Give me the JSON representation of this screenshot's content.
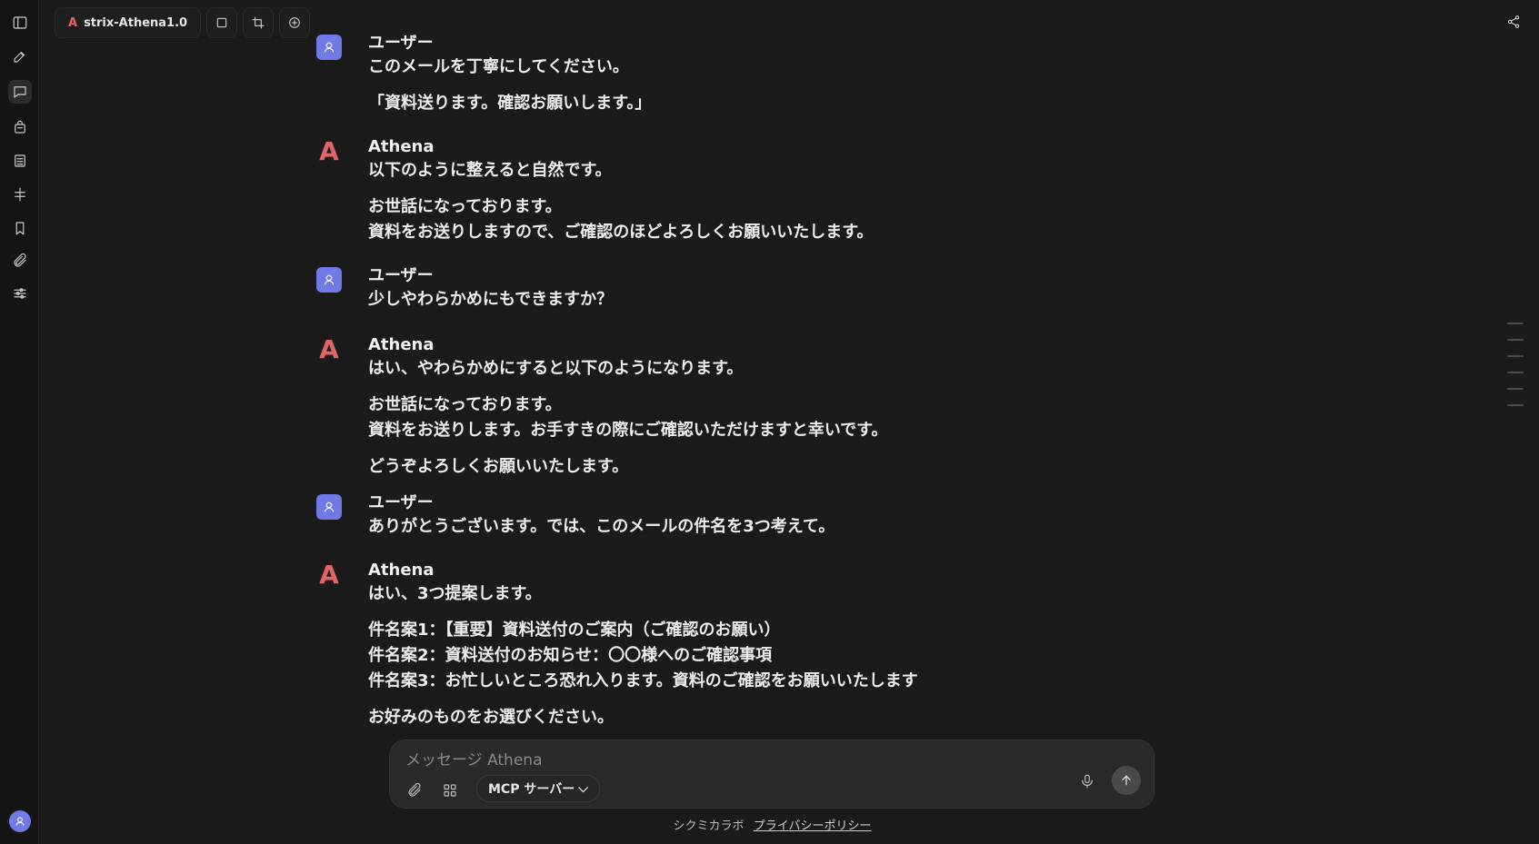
{
  "topbar": {
    "model_logo": "A",
    "model_name": "strix-Athena1.0"
  },
  "messages": [
    {
      "role": "user",
      "speaker": "ユーザー",
      "paragraphs": [
        [
          "このメールを丁寧にしてください。"
        ],
        [
          "「資料送ります。確認お願いします。」"
        ]
      ]
    },
    {
      "role": "ai",
      "speaker": "Athena",
      "paragraphs": [
        [
          "以下のように整えると自然です。"
        ],
        [
          "お世話になっております。",
          "資料をお送りしますので、ご確認のほどよろしくお願いいたします。"
        ]
      ]
    },
    {
      "role": "user",
      "speaker": "ユーザー",
      "paragraphs": [
        [
          "少しやわらかめにもできますか？"
        ]
      ]
    },
    {
      "role": "ai",
      "speaker": "Athena",
      "paragraphs": [
        [
          "はい、やわらかめにすると以下のようになります。"
        ],
        [
          "お世話になっております。",
          "資料をお送りします。お手すきの際にご確認いただけますと幸いです。"
        ],
        [
          "どうぞよろしくお願いいたします。"
        ]
      ]
    },
    {
      "role": "user",
      "speaker": "ユーザー",
      "paragraphs": [
        [
          "ありがとうございます。では、このメールの件名を3つ考えて。"
        ]
      ]
    },
    {
      "role": "ai",
      "speaker": "Athena",
      "paragraphs": [
        [
          "はい、3つ提案します。"
        ],
        [
          "件名案1：【重要】資料送付のご案内（ご確認のお願い）",
          "件名案2：資料送付のお知らせ：〇〇様へのご確認事項",
          "件名案3：お忙しいところ恐れ入ります。資料のご確認をお願いいたします"
        ],
        [
          "お好みのものをお選びください。"
        ]
      ]
    }
  ],
  "ai_logo": "A",
  "composer": {
    "placeholder": "メッセージ Athena",
    "mcp_label": "MCP サーバー",
    "mcp_chevron": "⌵"
  },
  "footer": {
    "brand": "シクミカラボ",
    "privacy": "プライバシーポリシー"
  },
  "colors": {
    "accent_ai": "#e06565",
    "user_avatar": "#6f7ae6",
    "background": "#1b1b1b"
  }
}
